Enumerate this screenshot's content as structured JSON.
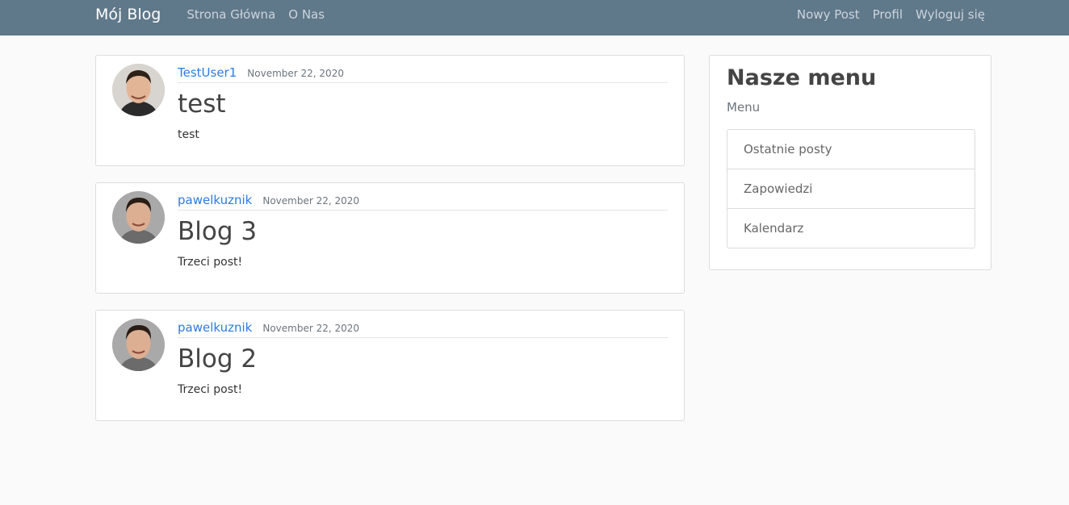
{
  "navbar": {
    "brand": "Mój Blog",
    "left_links": [
      "Strona Główna",
      "O Nas"
    ],
    "right_links": [
      "Nowy Post",
      "Profil",
      "Wyloguj się"
    ],
    "background": "#5f788a"
  },
  "posts": [
    {
      "author": "TestUser1",
      "date": "November 22, 2020",
      "title": "test",
      "content": "test"
    },
    {
      "author": "pawelkuznik",
      "date": "November 22, 2020",
      "title": "Blog 3",
      "content": "Trzeci post!"
    },
    {
      "author": "pawelkuznik",
      "date": "November 22, 2020",
      "title": "Blog 2",
      "content": "Trzeci post!"
    }
  ],
  "sidebar": {
    "title": "Nasze menu",
    "subtitle": "Menu",
    "items": [
      "Ostatnie posty",
      "Zapowiedzi",
      "Kalendarz"
    ]
  }
}
